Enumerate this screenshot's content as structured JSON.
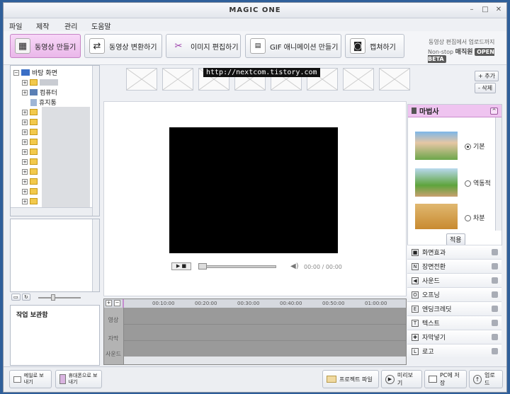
{
  "app": {
    "title": "MAGIC ONE"
  },
  "menu": [
    "파일",
    "제작",
    "관리",
    "도움말"
  ],
  "toolbar": [
    {
      "label": "동영상 만들기",
      "icon": "film-plus-icon",
      "active": true
    },
    {
      "label": "동영상 변환하기",
      "icon": "convert-icon",
      "active": false
    },
    {
      "label": "이미지 편집하기",
      "icon": "scissors-icon",
      "active": false
    },
    {
      "label": "GIF 애니메이션 만들기",
      "icon": "gif-icon",
      "active": false
    },
    {
      "label": "캡쳐하기",
      "icon": "camera-icon",
      "active": false
    }
  ],
  "promo": {
    "line1": "동영상 편집에서 업로드까지",
    "line2_prefix": "Non-stop",
    "line2_bold": "매직원",
    "badge": "OPEN BETA"
  },
  "tree": {
    "root": "바탕 화면",
    "computer": "컴퓨터",
    "trash": "휴지통"
  },
  "left": {
    "work_storage": "작업 보관함"
  },
  "media": {
    "add": "+ 추가",
    "delete": "- 삭제",
    "watermark": "http://nextcom.tistory.com"
  },
  "player": {
    "time": "00:00 / 00:00"
  },
  "wizard": {
    "title": "마법사",
    "options": [
      "기본",
      "역동적",
      "차분"
    ],
    "selected": 0,
    "apply": "적용"
  },
  "effects": [
    "화면효과",
    "장면전환",
    "사운드",
    "오프닝",
    "엔딩크레딧",
    "텍스트",
    "자막넣기",
    "로고"
  ],
  "timeline": {
    "ticks": [
      "00:10:00",
      "00:20:00",
      "00:30:00",
      "00:40:00",
      "00:50:00",
      "01:00:00"
    ],
    "tracks": [
      "영상",
      "자막",
      "사운드"
    ]
  },
  "bottom": {
    "mail": "메일로 보내기",
    "phone": "휴대폰으로 보내기",
    "project": "프로젝트 파일",
    "preview": "미리보기",
    "save_pc": "PC에 저장",
    "upload": "업로드"
  },
  "colors": {
    "accent": "#e9b7ea",
    "wizard_header": "#efc4f0",
    "video_bg": "#000000"
  }
}
